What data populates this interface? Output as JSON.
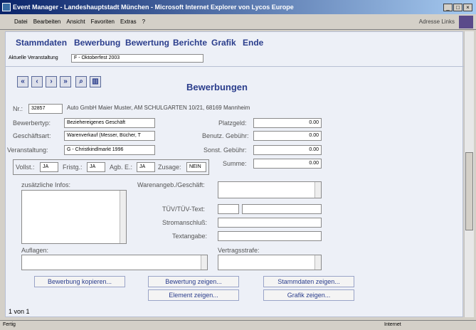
{
  "window": {
    "title": "Event Manager - Landeshauptstadt München - Microsoft Internet Explorer von Lycos Europe"
  },
  "menu": [
    "Datei",
    "Bearbeiten",
    "Ansicht",
    "Favoriten",
    "Extras",
    "?"
  ],
  "toolbar": {
    "right": "Adresse  Links"
  },
  "nav": [
    "Stammdaten",
    "Bewerbung",
    "Bewertung",
    "Berichte",
    "Grafik",
    "Ende"
  ],
  "current_event": {
    "label": "Aktuelle Veranstaltung",
    "value": "F - Oktoberfest 2003"
  },
  "page_title": "Bewerbungen",
  "form": {
    "nr_label": "Nr.:",
    "nr": "32857",
    "applicant": "Auto GmbH Maier Muster, AM SCHULGARTEN 10/21, 68169 Mannheim",
    "bewerbertyp_label": "Bewerbertyp:",
    "bewerbertyp": "Beziehereigenes Geschäft",
    "geschaeftsart_label": "Geschäftsart:",
    "geschaeftsart": "Warenverkauf (Messer, Bücher, T",
    "veranstaltung_label": "Veranstaltung:",
    "veranstaltung": "G - Christkindlmarkt 1996",
    "platzgeld_label": "Platzgeld:",
    "platzgeld": "0.00",
    "benutz_label": "Benutz. Gebühr:",
    "benutz": "0.00",
    "sonst_label": "Sonst. Gebühr:",
    "sonst": "0.00",
    "summe_label": "Summe:",
    "summe": "0.00",
    "vollst_label": "Vollst.:",
    "vollst": "JA",
    "fristg_label": "Fristg.:",
    "fristg": "JA",
    "agb_label": "Agb. E.:",
    "agb": "JA",
    "zusage_label": "Zusage:",
    "zusage": "NEIN",
    "infos_label": "zusätzliche Infos:",
    "warenangeb_label": "Warenangeb./Geschäft:",
    "tuev_label": "TÜV/TÜV-Text:",
    "strom_label": "Stromanschluß:",
    "text_label": "Textangabe:",
    "auflagen_label": "Auflagen:",
    "vertrag_label": "Vertragsstrafe:"
  },
  "buttons": {
    "kopieren": "Bewerbung kopieren...",
    "bewertung": "Bewertung zeigen...",
    "stammdaten": "Stammdaten zeigen...",
    "element": "Element zeigen...",
    "grafik": "Grafik zeigen..."
  },
  "record": "1 von 1",
  "status": {
    "left": "Fertig",
    "right": "Internet"
  }
}
